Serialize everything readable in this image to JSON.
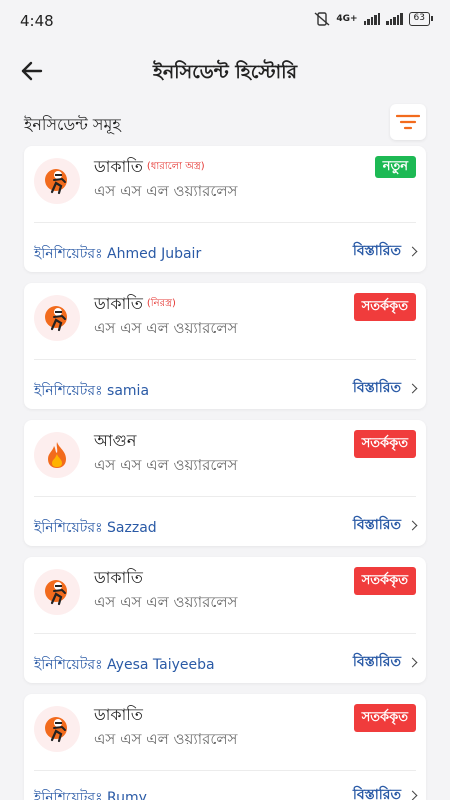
{
  "status_bar": {
    "time": "4:48",
    "network": "4G+",
    "battery": "63"
  },
  "header": {
    "title": "ইনসিডেন্ট হিস্টোরি"
  },
  "section": {
    "title": "ইনসিডেন্ট সমূহ"
  },
  "incidents": [
    {
      "type": "ডাকাতি",
      "sub": "(ধারালো অস্ত্র)",
      "company": "এস এস এল ওয়্যারলেস",
      "status": "নতুন",
      "status_color": "#1db954",
      "initiator": "ইনিশিয়েটরঃ Ahmed Jubair",
      "details": "বিস্তারিত",
      "icon": "robbery-icon"
    },
    {
      "type": "ডাকাতি",
      "sub": "(নিরস্ত্র)",
      "company": "এস এস এল ওয়্যারলেস",
      "status": "সতর্ককৃত",
      "status_color": "#f03c3c",
      "initiator": "ইনিশিয়েটরঃ samia",
      "details": "বিস্তারিত",
      "icon": "robbery-icon"
    },
    {
      "type": "আগুন",
      "sub": "",
      "company": "এস এস এল ওয়্যারলেস",
      "status": "সতর্ককৃত",
      "status_color": "#f03c3c",
      "initiator": "ইনিশিয়েটরঃ Sazzad",
      "details": "বিস্তারিত",
      "icon": "fire-icon"
    },
    {
      "type": "ডাকাতি",
      "sub": "",
      "company": "এস এস এল ওয়্যারলেস",
      "status": "সতর্ককৃত",
      "status_color": "#f03c3c",
      "initiator": "ইনিশিয়েটরঃ Ayesa Taiyeeba",
      "details": "বিস্তারিত",
      "icon": "robbery-icon"
    },
    {
      "type": "ডাকাতি",
      "sub": "",
      "company": "এস এস এল ওয়্যারলেস",
      "status": "সতর্ককৃত",
      "status_color": "#f03c3c",
      "initiator": "ইনিশিয়েটরঃ Rumy",
      "details": "বিস্তারিত",
      "icon": "robbery-icon"
    }
  ],
  "colors": {
    "link": "#2a5aa6",
    "filter_accent": "#f26b1d",
    "background": "#f4f4f6"
  }
}
